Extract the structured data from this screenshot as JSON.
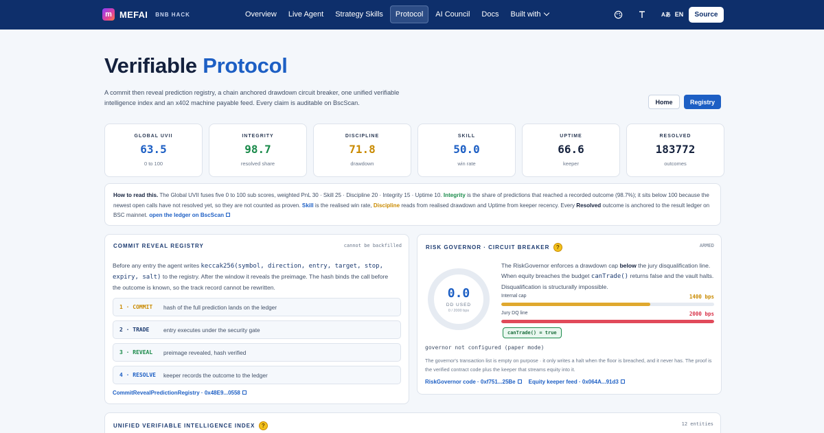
{
  "nav": {
    "logo_mark": "m",
    "brand": "MEFAI",
    "brand_sub": "BNB HACK",
    "links": [
      "Overview",
      "Live Agent",
      "Strategy Skills",
      "Protocol",
      "AI Council",
      "Docs",
      "Built with"
    ],
    "lang_icon": "Aあ",
    "lang": "EN",
    "source_label": "Source"
  },
  "hero": {
    "title_main": "Verifiable",
    "title_accent": "Protocol",
    "lede": "A commit then reveal prediction registry, a chain anchored drawdown circuit breaker, one unified verifiable intelligence index and an x402 machine payable feed. Every claim is auditable on BscScan.",
    "home_label": "Home",
    "registry_label": "Registry"
  },
  "stats": [
    {
      "label": "GLOBAL UVII",
      "value": "63.5",
      "sub": "0 to 100",
      "color": "#1d5fc4"
    },
    {
      "label": "INTEGRITY",
      "value": "98.7",
      "sub": "resolved share",
      "color": "#1a8a4a"
    },
    {
      "label": "DISCIPLINE",
      "value": "71.8",
      "sub": "drawdown",
      "color": "#c98a00"
    },
    {
      "label": "SKILL",
      "value": "50.0",
      "sub": "win rate",
      "color": "#1d5fc4"
    },
    {
      "label": "UPTIME",
      "value": "66.6",
      "sub": "keeper",
      "color": "#14213d"
    },
    {
      "label": "RESOLVED",
      "value": "183772",
      "sub": "outcomes",
      "color": "#14213d"
    }
  ],
  "howto": {
    "lead": "How to read this.",
    "t1": " The Global UVII fuses five 0 to 100 sub scores, weighted PnL 30 · Skill 25 · Discipline 20 · Integrity 15 · Uptime 10. ",
    "integrity": "Integrity",
    "t2": " is the share of predictions that reached a recorded outcome (98.7%); it sits below 100 because the newest open calls have not resolved yet, so they are not counted as proven. ",
    "skill": "Skill",
    "t3": " is the realised win rate, ",
    "discipline": "Discipline",
    "t4": " reads from realised drawdown and Uptime from keeper recency. Every ",
    "resolved": "Resolved",
    "t5": " outcome is anchored to the result ledger on BSC mainnet. ",
    "link": "open the ledger on BscScan"
  },
  "commit": {
    "title": "COMMIT REVEAL REGISTRY",
    "badge": "cannot be backfilled",
    "d1": "Before any entry the agent writes ",
    "code": "keccak256(symbol, direction, entry, target, stop, expiry, salt)",
    "d2": " to the registry. After the window it reveals the preimage. The hash binds the call before the outcome is known, so the track record cannot be rewritten.",
    "steps": [
      {
        "tag": "1 · COMMIT",
        "text": "hash of the full prediction lands on the ledger",
        "color": "#c98a00"
      },
      {
        "tag": "2 · TRADE",
        "text": "entry executes under the security gate",
        "color": "#1b3a70"
      },
      {
        "tag": "3 · REVEAL",
        "text": "preimage revealed, hash verified",
        "color": "#1a8a4a"
      },
      {
        "tag": "4 · RESOLVE",
        "text": "keeper records the outcome to the ledger",
        "color": "#1d5fc4"
      }
    ],
    "link": "CommitRevealPredictionRegistry · 0x48E9...0558"
  },
  "risk": {
    "title": "RISK GOVERNOR · CIRCUIT BREAKER",
    "status": "ARMED",
    "gauge_value": "0.0",
    "gauge_label": "DD USED",
    "gauge_sub": "0 / 2000 bps",
    "d1": "The RiskGovernor enforces a drawdown cap ",
    "d_bold": "below",
    "d2": " the jury disqualification line. When equity breaches the budget ",
    "d_code": "canTrade()",
    "d3": " returns false and the vault halts. Disqualification is structurally impossible.",
    "cap_label": "Internal cap",
    "cap_value": "1400 bps",
    "cap_fraction": 0.7,
    "dq_label": "Jury DQ line",
    "dq_value": "2000 bps",
    "dq_fraction": 1.0,
    "cantrade": "canTrade() = true",
    "gov_status": "governor not configured (paper mode)",
    "note": "The governor's transaction list is empty on purpose · it only writes a halt when the floor is breached, and it never has. The proof is the verified contract code plus the keeper that streams equity into it.",
    "link1": "RiskGovernor code · 0xf751...25Be",
    "link2": "Equity keeper feed · 0x064A...91d3",
    "colors": {
      "cap": "#e0a82e",
      "dq": "#e14a5a"
    }
  },
  "index": {
    "title": "UNIFIED VERIFIABLE INTELLIGENCE INDEX",
    "count": "12 entities"
  }
}
